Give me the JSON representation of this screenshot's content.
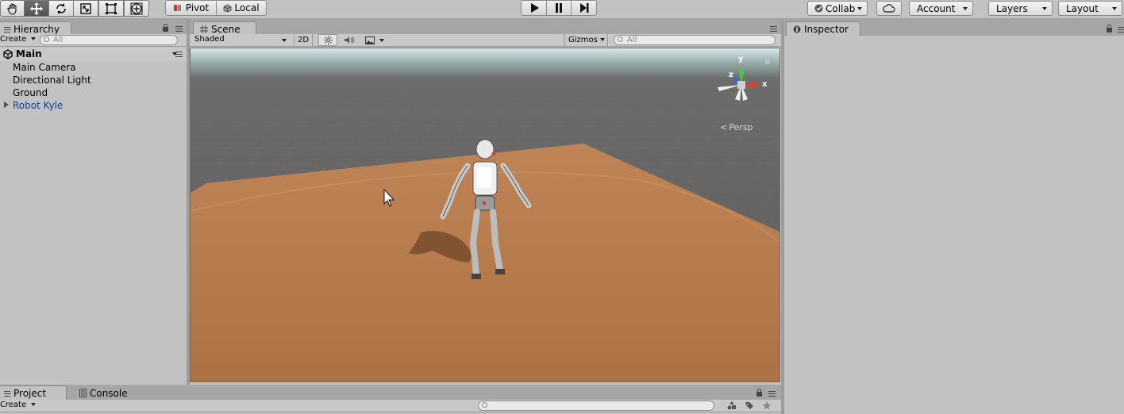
{
  "toolbar": {
    "pivot_label": "Pivot",
    "local_label": "Local",
    "collab_label": "Collab",
    "account_label": "Account",
    "layers_label": "Layers",
    "layout_label": "Layout"
  },
  "hierarchy": {
    "tab_label": "Hierarchy",
    "create_label": "Create",
    "search_placeholder": "All",
    "scene_name": "Main",
    "items": [
      "Main Camera",
      "Directional Light",
      "Ground",
      "Robot Kyle"
    ]
  },
  "scene": {
    "tab_label": "Scene",
    "shading_mode": "Shaded",
    "mode_2d_label": "2D",
    "gizmos_label": "Gizmos",
    "search_placeholder": "All",
    "projection_label": "Persp",
    "gizmo_axes": [
      "y",
      "z",
      "x"
    ]
  },
  "inspector": {
    "tab_label": "Inspector"
  },
  "bottom": {
    "project_tab": "Project",
    "console_tab": "Console",
    "create_label": "Create"
  },
  "colors": {
    "ground": "#b57a4c",
    "sky": "#6a6a6a",
    "prefab_text": "#1a3a8c"
  }
}
